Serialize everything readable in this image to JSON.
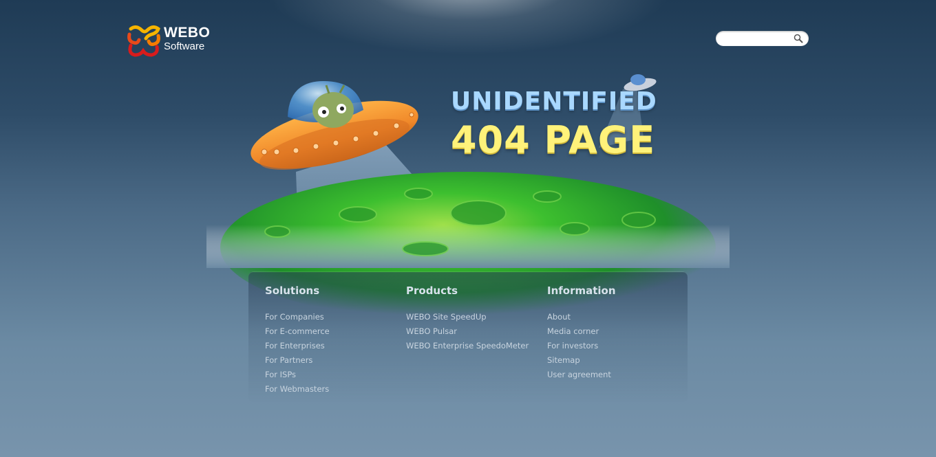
{
  "brand": {
    "name_line1": "WEBO",
    "name_line2": "Software"
  },
  "search": {
    "placeholder": "",
    "value": ""
  },
  "hero": {
    "line1": "UNIDENTIFIED",
    "line2": "404 PAGE"
  },
  "footer": {
    "columns": [
      {
        "title": "Solutions",
        "links": [
          "For Companies",
          "For E-commerce",
          "For Enterprises",
          "For Partners",
          "For ISPs",
          "For Webmasters"
        ]
      },
      {
        "title": "Products",
        "links": [
          "WEBO Site SpeedUp",
          "WEBO Pulsar",
          "WEBO Enterprise SpeedoMeter"
        ]
      },
      {
        "title": "Information",
        "links": [
          "About",
          "Media corner",
          "For investors",
          "Sitemap",
          "User agreement"
        ]
      }
    ]
  },
  "colors": {
    "headline_top": "#a9d8ff",
    "headline_bottom": "#fff27a",
    "planet": "#2fb82f",
    "ufo": "#f0892a"
  }
}
